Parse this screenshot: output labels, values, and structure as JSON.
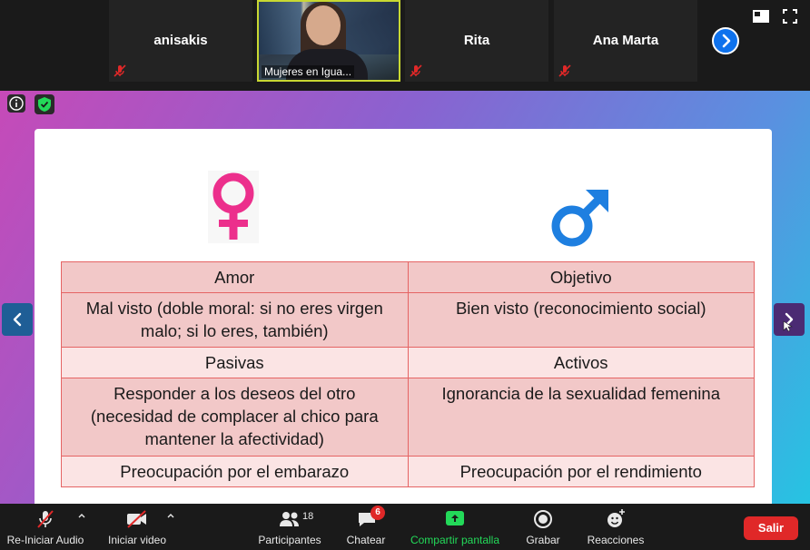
{
  "participants": [
    {
      "name": "anisakis",
      "muted": true
    },
    {
      "name": "Mujeres en Igua...",
      "muted": false,
      "video": true
    },
    {
      "name": "Rita",
      "muted": true
    },
    {
      "name": "Ana Marta",
      "muted": true
    }
  ],
  "slide": {
    "symbols": {
      "female": "female-symbol-icon",
      "male": "male-symbol-icon"
    },
    "rows": [
      [
        "Amor",
        "Objetivo"
      ],
      [
        "Mal visto (doble moral: si no eres virgen malo; si lo eres, también)",
        "Bien visto (reconocimiento social)"
      ],
      [
        "Pasivas",
        "Activos"
      ],
      [
        "Responder a los deseos del otro (necesidad de complacer al chico para mantener la afectividad)",
        "Ignorancia de la sexualidad femenina"
      ],
      [
        "Preocupación por el embarazo",
        "Preocupación por el rendimiento"
      ]
    ]
  },
  "toolbar": {
    "audio_label": "Re-Iniciar Audio",
    "video_label": "Iniciar video",
    "participants_label": "Participantes",
    "participants_count": "18",
    "chat_label": "Chatear",
    "chat_badge": "6",
    "share_label": "Compartir pantalla",
    "record_label": "Grabar",
    "reactions_label": "Reacciones",
    "leave_label": "Salir"
  },
  "colors": {
    "accent": "#0e72ed",
    "share": "#23d959",
    "leave": "#e02828",
    "female_symbol": "#ec2f8c",
    "male_symbol": "#1e7fe0",
    "table_border": "#e56464"
  }
}
